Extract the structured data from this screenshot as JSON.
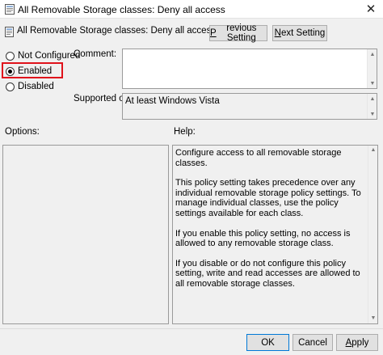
{
  "window": {
    "title": "All Removable Storage classes: Deny all access",
    "close_glyph": "✕"
  },
  "header": {
    "title": "All Removable Storage classes: Deny all access"
  },
  "nav": {
    "previous_prefix": "P",
    "previous_rest": "revious Setting",
    "next_prefix": "N",
    "next_rest": "ext Setting"
  },
  "state": {
    "not_configured_label": "Not Configured",
    "enabled_label": "Enabled",
    "disabled_label": "Disabled",
    "selected": "enabled"
  },
  "comment": {
    "label": "Comment:",
    "value": ""
  },
  "supported": {
    "label": "Supported on:",
    "value": "At least Windows Vista"
  },
  "options": {
    "label": "Options:"
  },
  "help": {
    "label": "Help:",
    "paragraphs": [
      "Configure access to all removable storage classes.",
      "This policy setting takes precedence over any individual removable storage policy settings. To manage individual classes, use the policy settings available for each class.",
      "If you enable this policy setting, no access is allowed to any removable storage class.",
      "If you disable or do not configure this policy setting, write and read accesses are allowed to all removable storage classes."
    ]
  },
  "footer": {
    "ok_label": "OK",
    "cancel_label": "Cancel",
    "apply_prefix": "A",
    "apply_rest": "pply"
  },
  "colors": {
    "highlight": "#e0121b",
    "background": "#f0f0f0"
  },
  "icons": {
    "title": "policy-document-icon",
    "header": "policy-document-icon",
    "close": "close-icon"
  }
}
